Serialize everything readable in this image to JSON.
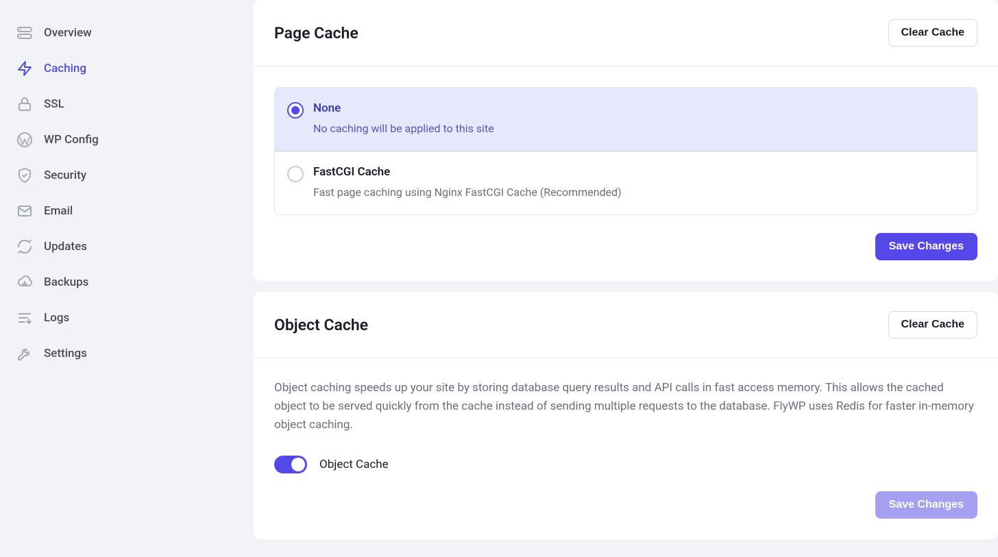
{
  "sidebar": {
    "items": [
      {
        "label": "Overview"
      },
      {
        "label": "Caching"
      },
      {
        "label": "SSL"
      },
      {
        "label": "WP Config"
      },
      {
        "label": "Security"
      },
      {
        "label": "Email"
      },
      {
        "label": "Updates"
      },
      {
        "label": "Backups"
      },
      {
        "label": "Logs"
      },
      {
        "label": "Settings"
      }
    ]
  },
  "page_cache": {
    "title": "Page Cache",
    "clear_label": "Clear Cache",
    "options": [
      {
        "title": "None",
        "desc": "No caching will be applied to this site"
      },
      {
        "title": "FastCGI Cache",
        "desc": "Fast page caching using Nginx FastCGI Cache (Recommended)"
      }
    ],
    "save_label": "Save Changes"
  },
  "object_cache": {
    "title": "Object Cache",
    "clear_label": "Clear Cache",
    "description": "Object caching speeds up your site by storing database query results and API calls in fast access memory. This allows the cached object to be served quickly from the cache instead of sending multiple requests to the database. FlyWP uses Redis for faster in-memory object caching.",
    "toggle_label": "Object Cache",
    "save_label": "Save Changes"
  }
}
